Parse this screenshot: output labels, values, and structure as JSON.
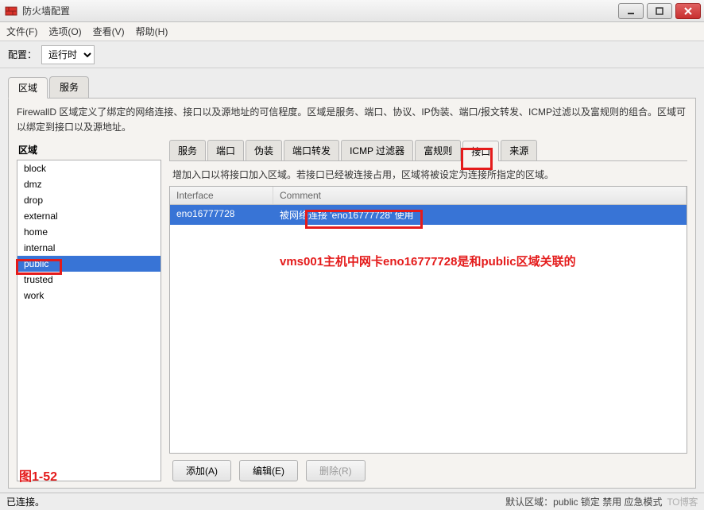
{
  "window": {
    "title": "防火墙配置"
  },
  "menu": {
    "file": "文件(F)",
    "options": "选项(O)",
    "view": "查看(V)",
    "help": "帮助(H)"
  },
  "config": {
    "label": "配置：",
    "selected": "运行时"
  },
  "topTabs": {
    "zone": "区域",
    "service": "服务"
  },
  "description": "FirewallD 区域定义了绑定的网络连接、接口以及源地址的可信程度。区域是服务、端口、协议、IP伪装、端口/报文转发、ICMP过滤以及富规则的组合。区域可以绑定到接口以及源地址。",
  "zone_heading": "区域",
  "zones": [
    "block",
    "dmz",
    "drop",
    "external",
    "home",
    "internal",
    "public",
    "trusted",
    "work"
  ],
  "selected_zone_index": 6,
  "innerTabs": {
    "service": "服务",
    "port": "端口",
    "masq": "伪装",
    "pf": "端口转发",
    "icmp": "ICMP 过滤器",
    "rich": "富规则",
    "iface": "接口",
    "source": "来源"
  },
  "active_inner_tab": "iface",
  "iface_hint": "增加入口以将接口加入区域。若接口已经被连接占用，区域将被设定为连接所指定的区域。",
  "iface_headers": {
    "c1": "Interface",
    "c2": "Comment"
  },
  "iface_rows": [
    {
      "iface": "eno16777728",
      "comment": "被网络连接 'eno16777728' 使用"
    }
  ],
  "buttons": {
    "add": "添加(A)",
    "edit": "编辑(E)",
    "delete": "删除(R)"
  },
  "status": {
    "left": "已连接。",
    "right_label": "默认区域：",
    "right_zone": "public",
    "right_actions": "锁定 禁用 应急模式",
    "watermark": "TO博客"
  },
  "annotation_text": "vms001主机中网卡eno16777728是和public区域关联的",
  "fig_label": "图1-52"
}
